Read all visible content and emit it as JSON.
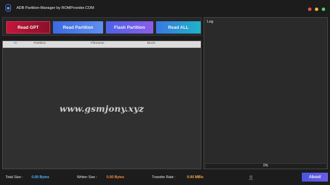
{
  "window": {
    "title": "ADB Partition-Manager by ROMProvider.COM"
  },
  "toolbar": {
    "read_gpt": "Read GPT",
    "read_partition": "Read Partition",
    "flash_partition": "Flash  Partition",
    "read_all": "Read ALL"
  },
  "table": {
    "columns": [
      "ID",
      "Partition",
      "Filename",
      "Block"
    ],
    "rows": []
  },
  "watermark": "www.gsmjony.xyz",
  "log": {
    "label": "Log",
    "progress_text": "0%",
    "progress_fraction": 0
  },
  "status": {
    "total_label": "Total Size :",
    "total_value": "0.00 Bytes",
    "written_label": "Writen Size :",
    "written_value": "0.00 Bytes",
    "rate_label": "Transfer Rate :",
    "rate_value": "0.00 MB/s",
    "about": "About"
  },
  "colors": {
    "total_value": "#4fb4ff",
    "written_value": "#ff8c3a",
    "rate_value": "#ffa84a",
    "read_gpt_button": "#c4163a",
    "accent_blue": "#3b6be0"
  },
  "icons": {
    "app": "app-logo-icon",
    "status_user": "user-icon"
  }
}
